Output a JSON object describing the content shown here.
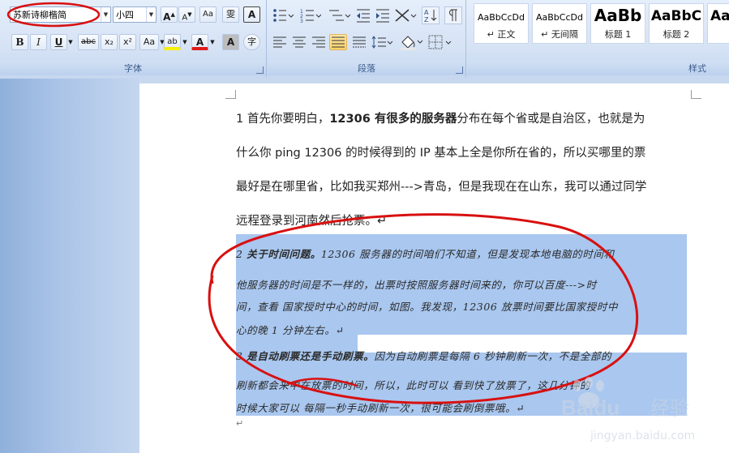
{
  "ribbon": {
    "font_group": {
      "label": "字体",
      "font_name": "苏新诗柳楷简",
      "font_size": "小四",
      "grow": "A",
      "shrink": "A",
      "clear_format": "Aa",
      "phonetic": "雯",
      "border_char": "A",
      "bold": "B",
      "italic": "I",
      "underline": "U",
      "strike": "abc",
      "subscript": "x₂",
      "superscript": "x²",
      "change_case": "Aa",
      "highlight": "ab",
      "font_color": "A",
      "shade_char": "A",
      "enclose": "字"
    },
    "para_group": {
      "label": "段落"
    },
    "styles_group": {
      "label": "样式",
      "styles": [
        {
          "sample": "AaBbCcDd",
          "name": "↵ 正文"
        },
        {
          "sample": "AaBbCcDd",
          "name": "↵ 无间隔"
        },
        {
          "sample": "AaBb",
          "name": "标题 1"
        },
        {
          "sample": "AaBbC",
          "name": "标题 2"
        },
        {
          "sample": "Aa",
          "name": ""
        }
      ]
    }
  },
  "document": {
    "p1": {
      "line1_a": "1   首先你要明白，",
      "line1_b": "12306 有很多的服务器",
      "line1_c": "分布在每个省或是自治区，也就是为",
      "line2": "什么你 ping 12306 的时候得到的 IP  基本上全是你所在省的，所以买哪里的票",
      "line3": "最好是在哪里省，比如我买郑州--->青岛，但是我现在在山东，我可以通过同学",
      "line4": "远程登录到河南然后抢票。↵"
    },
    "p2": {
      "line1_a": "2   ",
      "line1_b": "关于时间问题。",
      "line1_c": "12306 服务器的时间咱们不知道，但是发现本地电脑的时间和",
      "line2": "他服务器的时间是不一样的，出票时按照服务器时间来的，你可以百度--->时",
      "line3": "间，查看  国家授时中心的时间，如图。我发现，12306 放票时间要比国家授时中",
      "line4": "心的晚 1 分钟左右。↵"
    },
    "p3": {
      "line1_a": "3   ",
      "line1_b": "是自动刷票还是手动刷票。",
      "line1_c": "因为自动刷票是每隔 6 秒钟刷新一次，不是全部的",
      "line2": "刷新都会来中在放票的时间，所以，此时可以  看到快了放票了，这几分钟的",
      "line3": "时候大家可以  每隔一秒手动刷新一次，很可能会刷倒票哦。↵"
    },
    "end_mark": "↵"
  },
  "watermark": {
    "brand": "Baidu",
    "sub": "经验",
    "url": "jingyan.baidu.com"
  },
  "colors": {
    "selection": "#a9c7ef",
    "annotation": "#d81010",
    "ribbon": "#d6e3f5"
  }
}
